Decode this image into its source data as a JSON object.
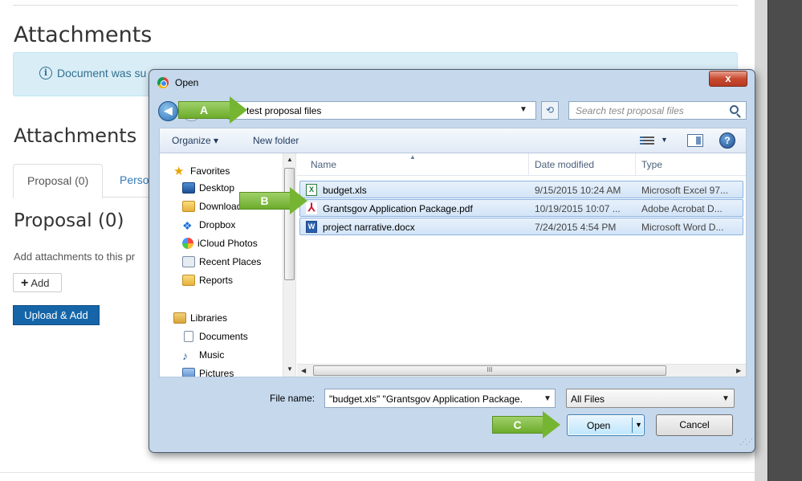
{
  "page": {
    "heading": "Attachments",
    "alert_text": "Document was su",
    "section_heading": "Attachments",
    "tabs": [
      {
        "label": "Proposal (0)"
      },
      {
        "label": "Perso"
      }
    ],
    "proposal_heading": "Proposal (0)",
    "hint_text": "Add attachments to this pr",
    "add_label": "Add",
    "upload_label": "Upload & Add"
  },
  "dialog": {
    "title": "Open",
    "close_label": "x",
    "address": "test proposal files",
    "search_placeholder": "Search test proposal files",
    "toolbar": {
      "organize_label": "Organize ▾",
      "new_folder_label": "New folder"
    },
    "nav_items": [
      {
        "label": "Favorites",
        "icon": "star-icon"
      },
      {
        "label": "Desktop",
        "icon": "desktop-icon"
      },
      {
        "label": "Downloads",
        "icon": "folder-icon"
      },
      {
        "label": "Dropbox",
        "icon": "dropbox-icon"
      },
      {
        "label": "iCloud Photos",
        "icon": "icloud-icon"
      },
      {
        "label": "Recent Places",
        "icon": "recent-places-icon"
      },
      {
        "label": "Reports",
        "icon": "folder-icon"
      },
      {
        "label": "Libraries",
        "icon": "library-icon"
      },
      {
        "label": "Documents",
        "icon": "document-icon"
      },
      {
        "label": "Music",
        "icon": "music-icon"
      },
      {
        "label": "Pictures",
        "icon": "pictures-icon"
      }
    ],
    "columns": {
      "name": "Name",
      "date": "Date modified",
      "type": "Type"
    },
    "files": [
      {
        "name": "budget.xls",
        "date": "9/15/2015 10:24 AM",
        "type": "Microsoft Excel 97...",
        "icon": "excel-file-icon"
      },
      {
        "name": "Grantsgov Application Package.pdf",
        "date": "10/19/2015 10:07 ...",
        "type": "Adobe Acrobat D...",
        "icon": "pdf-file-icon"
      },
      {
        "name": "project narrative.docx",
        "date": "7/24/2015 4:54 PM",
        "type": "Microsoft Word D...",
        "icon": "word-file-icon"
      }
    ],
    "file_name_label": "File name:",
    "file_name_value": "\"budget.xls\" \"Grantsgov Application Package.",
    "file_type_value": "All Files",
    "open_label": "Open",
    "cancel_label": "Cancel"
  },
  "callouts": {
    "a": "A",
    "b": "B",
    "c": "C"
  },
  "colors": {
    "alert_bg": "#d9edf7",
    "primary_button": "#1565a8",
    "callout_green": "#75b532",
    "selection_blue": "#d2e4f7"
  }
}
